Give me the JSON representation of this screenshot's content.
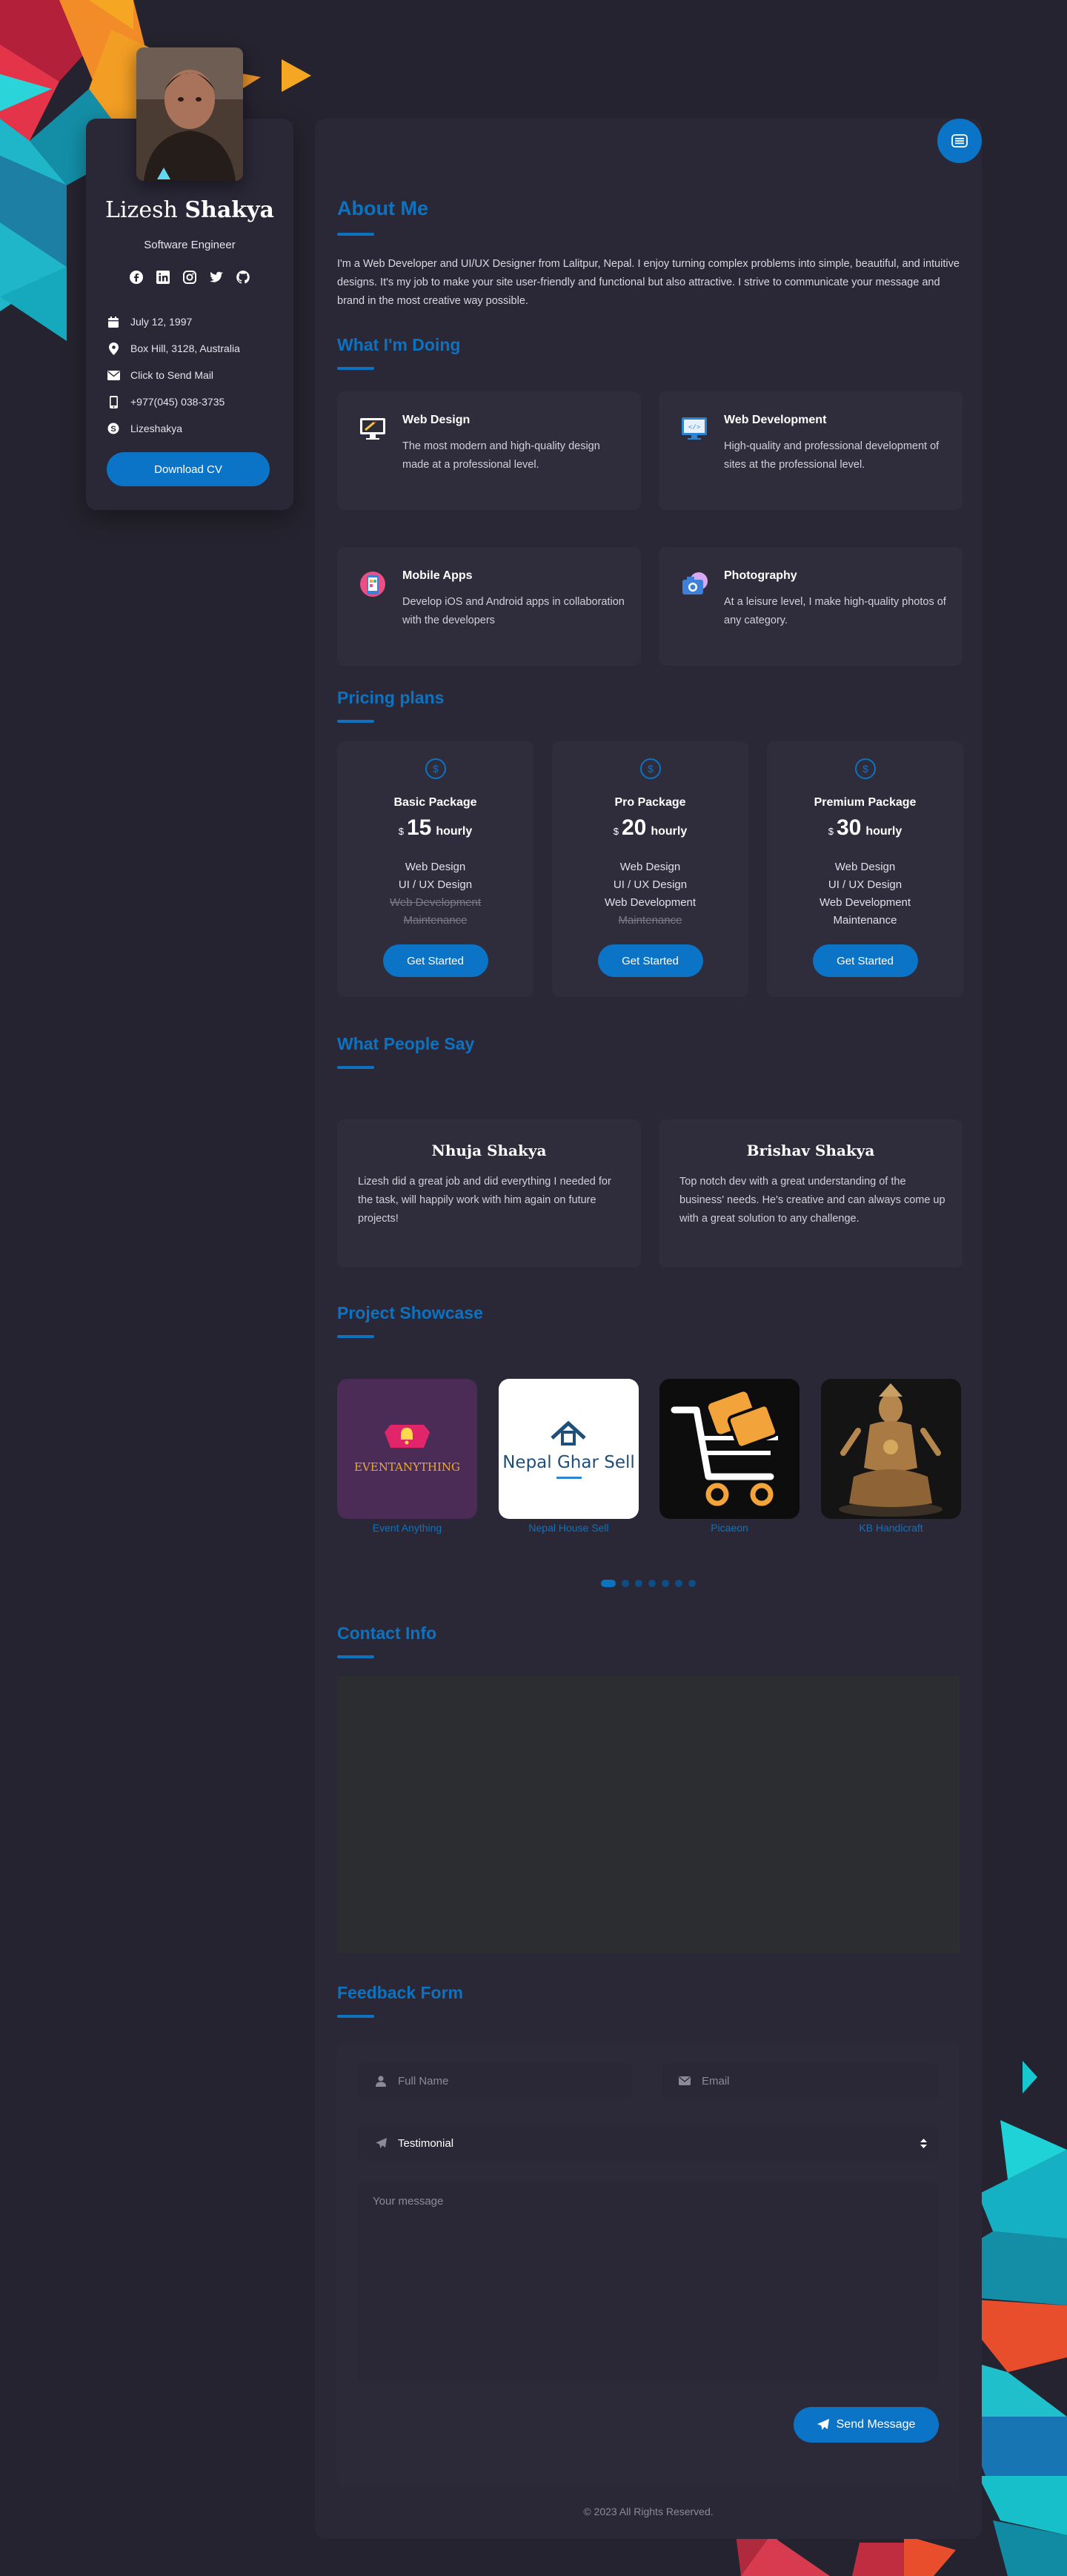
{
  "profile": {
    "first_name": "Lizesh",
    "last_name": "Shakya",
    "role": "Software Engineer",
    "birthday": "July 12, 1997",
    "address": "Box Hill, 3128, Australia",
    "email_label": "Click to Send Mail",
    "phone": "+977(045) 038-3735",
    "skype": "Lizeshakya",
    "download_label": "Download CV",
    "social_icons": [
      "facebook-icon",
      "linkedin-icon",
      "instagram-icon",
      "twitter-icon",
      "github-icon"
    ]
  },
  "about": {
    "title": "About Me",
    "text": "I'm a Web Developer and UI/UX Designer from Lalitpur, Nepal. I enjoy turning complex problems into simple, beautiful, and intuitive designs. It's my job to make your site user-friendly and functional but also attractive. I strive to communicate your message and brand in the most creative way possible."
  },
  "services": {
    "title": "What I'm Doing",
    "items": [
      {
        "title": "Web Design",
        "text": "The most modern and high-quality design made at a professional level."
      },
      {
        "title": "Web Development",
        "text": "High-quality and professional development of sites at the professional level."
      },
      {
        "title": "Mobile Apps",
        "text": "Develop iOS and Android apps in collaboration with the developers"
      },
      {
        "title": "Photography",
        "text": "At a leisure level, I make high-quality photos of any category."
      }
    ]
  },
  "pricing": {
    "title": "Pricing plans",
    "plans": [
      {
        "name": "Basic Package",
        "currency": "$",
        "amount": "15",
        "period": "hourly",
        "features": [
          "Web Design",
          "UI / UX Design",
          "Web Development",
          "Maintenance"
        ],
        "included": [
          true,
          true,
          false,
          false
        ],
        "button": "Get Started"
      },
      {
        "name": "Pro Package",
        "currency": "$",
        "amount": "20",
        "period": "hourly",
        "features": [
          "Web Design",
          "UI / UX Design",
          "Web Development",
          "Maintenance"
        ],
        "included": [
          true,
          true,
          true,
          false
        ],
        "button": "Get Started"
      },
      {
        "name": "Premium Package",
        "currency": "$",
        "amount": "30",
        "period": "hourly",
        "features": [
          "Web Design",
          "UI / UX Design",
          "Web Development",
          "Maintenance"
        ],
        "included": [
          true,
          true,
          true,
          true
        ],
        "button": "Get Started"
      }
    ]
  },
  "testimonials": {
    "title": "What People Say",
    "items": [
      {
        "name": "Nhuja Shakya",
        "text": "Lizesh did a great job and did everything I needed for the task, will happily work with him again on future projects!"
      },
      {
        "name": "Brishav Shakya",
        "text": "Top notch dev with a great understanding of the business' needs. He's creative and can always come up with a great solution to any challenge."
      }
    ]
  },
  "projects": {
    "title": "Project Showcase",
    "items": [
      {
        "label": "Event Anything",
        "logo_text": "EVENTANYTHING"
      },
      {
        "label": "Nepal House Sell",
        "logo_text": "Nepal Ghar Sell"
      },
      {
        "label": "Picaeon"
      },
      {
        "label": "KB Handicraft"
      }
    ],
    "slider_dots": 7,
    "active_dot": 0
  },
  "contact": {
    "title": "Contact Info"
  },
  "feedback": {
    "title": "Feedback Form",
    "name_placeholder": "Full Name",
    "email_placeholder": "Email",
    "select_value": "Testimonial",
    "message_placeholder": "Your message",
    "send_label": "Send Message"
  },
  "footer": {
    "text": "© 2023 All Rights Reserved."
  },
  "colors": {
    "accent": "#0d72c0",
    "button": "#0b74c7",
    "background": "#25232f",
    "card": "#2a2837"
  }
}
